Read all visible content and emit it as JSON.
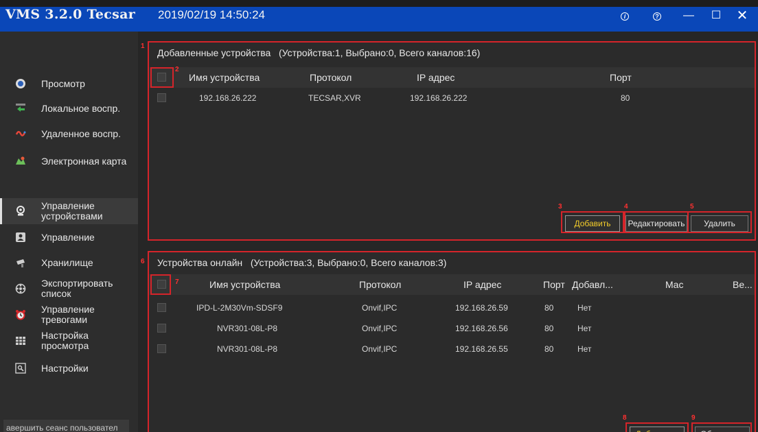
{
  "titlebar": {
    "app_title": "VMS 3.2.0 Tecsar",
    "datetime": "2019/02/19 14:50:24",
    "info_icon": "info-circle-icon",
    "help_icon": "help-circle-icon",
    "min_glyph": "—",
    "max_glyph": "☐",
    "close_glyph": "✕"
  },
  "sidebar": {
    "items": [
      {
        "label": "Просмотр",
        "icon": "live-view-icon"
      },
      {
        "label": "Локальное воспр.",
        "icon": "local-playback-icon"
      },
      {
        "label": "Удаленное воспр.",
        "icon": "remote-playback-icon"
      },
      {
        "label": "Электронная карта",
        "icon": "map-icon"
      },
      {
        "label": "Управление устройствами",
        "icon": "device-management-icon"
      },
      {
        "label": "Управление",
        "icon": "user-management-icon"
      },
      {
        "label": "Хранилище",
        "icon": "storage-icon"
      },
      {
        "label": "Экспортировать список",
        "icon": "export-icon"
      },
      {
        "label": "Управление тревогами",
        "icon": "alarm-clock-icon"
      },
      {
        "label": "Настройка просмотра",
        "icon": "grid-layout-icon"
      },
      {
        "label": "Настройки",
        "icon": "settings-icon"
      }
    ],
    "logout_label": "авершить сеанс пользовател"
  },
  "added_panel": {
    "title": "Добавленные устройства",
    "summary": "(Устройства:1, Выбрано:0, Всего каналов:16)",
    "badge": "1",
    "checkbox_badge": "2",
    "columns": [
      "Имя устройства",
      "Протокол",
      "IP адрес",
      "Порт"
    ],
    "rows": [
      {
        "name": "192.168.26.222",
        "protocol": "TECSAR,XVR",
        "ip": "192.168.26.222",
        "port": "80"
      }
    ],
    "buttons": {
      "add": {
        "label": "Добавить",
        "badge": "3"
      },
      "edit": {
        "label": "Редактировать",
        "badge": "4"
      },
      "delete": {
        "label": "Удалить",
        "badge": "5"
      }
    }
  },
  "online_panel": {
    "title": "Устройства онлайн",
    "summary": "(Устройства:3, Выбрано:0, Всего каналов:3)",
    "badge": "6",
    "checkbox_badge": "7",
    "columns": [
      "Имя устройства",
      "Протокол",
      "IP адрес",
      "Порт",
      "Добавл...",
      "Mac",
      "Ве..."
    ],
    "rows": [
      {
        "name": "IPD-L-2M30Vm-SDSF9",
        "protocol": "Onvif,IPC",
        "ip": "192.168.26.59",
        "port": "80",
        "added": "Нет"
      },
      {
        "name": "NVR301-08L-P8",
        "protocol": "Onvif,IPC",
        "ip": "192.168.26.56",
        "port": "80",
        "added": "Нет"
      },
      {
        "name": "NVR301-08L-P8",
        "protocol": "Onvif,IPC",
        "ip": "192.168.26.55",
        "port": "80",
        "added": "Нет"
      }
    ],
    "buttons": {
      "add_to": {
        "label": "Добавить в",
        "badge": "8"
      },
      "refresh": {
        "label": "Обновить ▾",
        "badge": "9"
      }
    }
  },
  "colors": {
    "titlebar": "#0a47b8",
    "highlight": "#d6242a",
    "primary_text": "#f4cd2a"
  }
}
